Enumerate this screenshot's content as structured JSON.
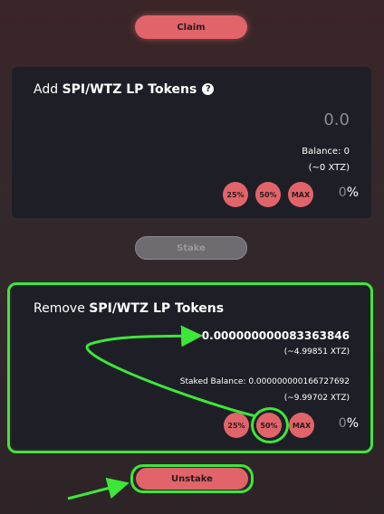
{
  "claim": {
    "label": "Claim"
  },
  "add": {
    "title_prefix": "Add ",
    "title_bold": "SPI/WTZ LP Tokens",
    "help_icon": "?",
    "amount": "0.0",
    "balance": "Balance: 0",
    "balance_xtz": "(~0 XTZ)",
    "pct_buttons": [
      "25%",
      "50%",
      "MAX"
    ],
    "pct_value": "0",
    "pct_symbol": "%"
  },
  "stake": {
    "label": "Stake"
  },
  "remove": {
    "title_prefix": "Remove ",
    "title_bold": "SPI/WTZ LP Tokens",
    "amount": "0.000000000083363846",
    "amount_xtz": "(~4.99851 XTZ)",
    "staked_balance": "Staked Balance: 0.000000000166727692",
    "staked_xtz": "(~9.99702 XTZ)",
    "pct_buttons": [
      "25%",
      "50%",
      "MAX"
    ],
    "pct_value": "0",
    "pct_symbol": "%"
  },
  "unstake": {
    "label": "Unstake"
  },
  "colors": {
    "accent": "#e0646a",
    "card": "#1e1f26",
    "annotation": "#3ee63a"
  }
}
